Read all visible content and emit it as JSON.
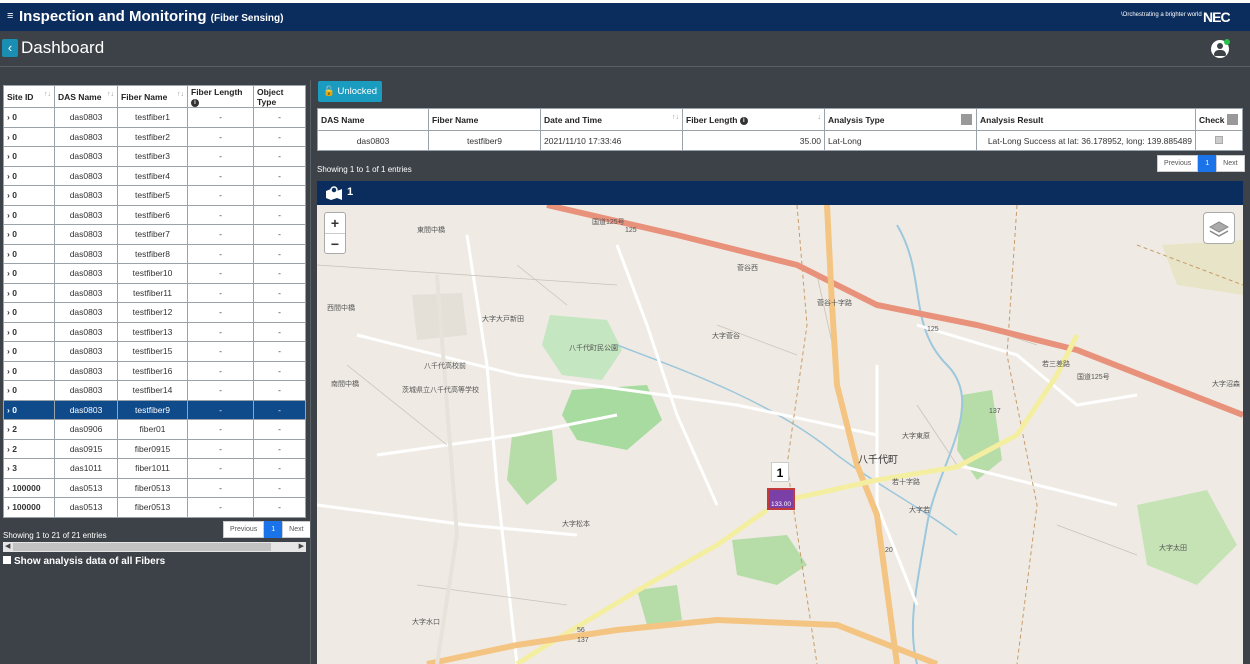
{
  "topbar": {
    "menu_icon": "≡",
    "title": "Inspection and Monitoring",
    "subtitle": "(Fiber Sensing)",
    "tagline": "\\Orchestrating a brighter world",
    "logo": "NEC"
  },
  "header": {
    "back_icon": "‹",
    "title": "Dashboard"
  },
  "left_table": {
    "columns": [
      "Site ID",
      "DAS Name",
      "Fiber Name",
      "Fiber Length",
      "Object Type"
    ],
    "rows": [
      [
        "0",
        "das0803",
        "testfiber1",
        "-",
        "-"
      ],
      [
        "0",
        "das0803",
        "testfiber2",
        "-",
        "-"
      ],
      [
        "0",
        "das0803",
        "testfiber3",
        "-",
        "-"
      ],
      [
        "0",
        "das0803",
        "testfiber4",
        "-",
        "-"
      ],
      [
        "0",
        "das0803",
        "testfiber5",
        "-",
        "-"
      ],
      [
        "0",
        "das0803",
        "testfiber6",
        "-",
        "-"
      ],
      [
        "0",
        "das0803",
        "testfiber7",
        "-",
        "-"
      ],
      [
        "0",
        "das0803",
        "testfiber8",
        "-",
        "-"
      ],
      [
        "0",
        "das0803",
        "testfiber10",
        "-",
        "-"
      ],
      [
        "0",
        "das0803",
        "testfiber11",
        "-",
        "-"
      ],
      [
        "0",
        "das0803",
        "testfiber12",
        "-",
        "-"
      ],
      [
        "0",
        "das0803",
        "testfiber13",
        "-",
        "-"
      ],
      [
        "0",
        "das0803",
        "testfiber15",
        "-",
        "-"
      ],
      [
        "0",
        "das0803",
        "testfiber16",
        "-",
        "-"
      ],
      [
        "0",
        "das0803",
        "testfiber14",
        "-",
        "-"
      ],
      [
        "0",
        "das0803",
        "testfiber9",
        "-",
        "-"
      ],
      [
        "2",
        "das0906",
        "fiber01",
        "-",
        "-"
      ],
      [
        "2",
        "das0915",
        "fiber0915",
        "-",
        "-"
      ],
      [
        "3",
        "das1011",
        "fiber1011",
        "-",
        "-"
      ],
      [
        "100000",
        "das0513",
        "fiber0513",
        "-",
        "-"
      ],
      [
        "100000",
        "das0513",
        "fiber0513",
        "-",
        "-"
      ]
    ],
    "selected_row": 15,
    "info": "Showing 1 to 21 of 21 entries",
    "pager": {
      "prev": "Previous",
      "page": "1",
      "next": "Next"
    },
    "show_all_label": "Show analysis data of all Fibers"
  },
  "right": {
    "unlock_label": "Unlocked",
    "columns": [
      "DAS Name",
      "Fiber Name",
      "Date and Time",
      "Fiber Length",
      "Analysis Type",
      "Analysis Result",
      "Check"
    ],
    "row": [
      "das0803",
      "testfiber9",
      "2021/11/10 17:33:46",
      "35.00",
      "Lat-Long",
      "Lat-Long Success at lat: 36.178952, long: 139.885489"
    ],
    "info": "Showing 1 to 1 of 1 entries",
    "pager": {
      "prev": "Previous",
      "page": "1",
      "next": "Next"
    }
  },
  "map": {
    "title_count": "1",
    "zoom_in": "+",
    "zoom_out": "−",
    "marker_count": "1",
    "marker_label": "133.00",
    "labels": [
      "国道125号",
      "125",
      "東間中橋",
      "西間中橋",
      "大字大戸新田",
      "八千代町民公園",
      "八千代高校前",
      "茨城県立八千代高等学校",
      "南間中橋",
      "八千代町",
      "大字東原",
      "若十字路",
      "大字若",
      "大字松本",
      "大字太田",
      "大字水口",
      "国道125号",
      "大字沼森",
      "125",
      "20",
      "56",
      "137",
      "137",
      "大字菅谷",
      "菅谷西",
      "菅谷十字路",
      "若三差路"
    ]
  },
  "colors": {
    "header": "#0b2d5e",
    "accent": "#1a9bc0",
    "selected": "#0f4a8a"
  }
}
